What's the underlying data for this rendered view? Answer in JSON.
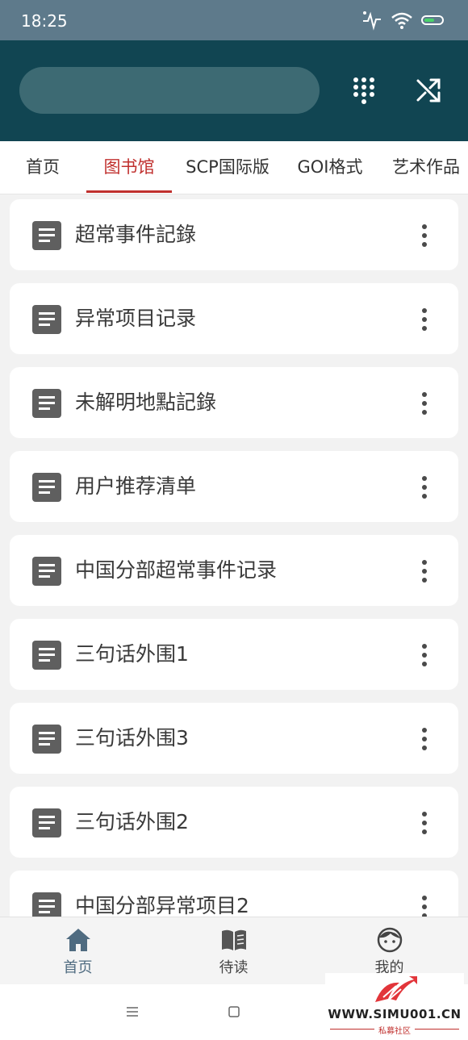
{
  "status_bar": {
    "time": "18:25"
  },
  "tabs": [
    {
      "label": "首页",
      "active": false
    },
    {
      "label": "图书馆",
      "active": true
    },
    {
      "label": "SCP国际版",
      "active": false
    },
    {
      "label": "GOI格式",
      "active": false
    },
    {
      "label": "艺术作品",
      "active": false
    }
  ],
  "list": {
    "items": [
      {
        "title": "超常事件記錄"
      },
      {
        "title": "异常项目记录"
      },
      {
        "title": "未解明地點記錄"
      },
      {
        "title": "用户推荐清单"
      },
      {
        "title": "中国分部超常事件记录"
      },
      {
        "title": "三句话外围1"
      },
      {
        "title": "三句话外围3"
      },
      {
        "title": "三句话外围2"
      },
      {
        "title": "中国分部异常项目2"
      }
    ]
  },
  "bottom_nav": {
    "items": [
      {
        "label": "首页",
        "icon": "home-icon",
        "active": true
      },
      {
        "label": "待读",
        "icon": "book-icon",
        "active": false
      },
      {
        "label": "我的",
        "icon": "face-icon",
        "active": false
      }
    ]
  },
  "watermark": {
    "text": "WWW.SIMU001.CN",
    "subtitle": "私募社区"
  },
  "colors": {
    "status_bar": "#5e7a8b",
    "header": "#114552",
    "search_box": "#3d6a73",
    "accent": "#c0302e",
    "nav_active": "#4f6b80",
    "background": "#f2f2f2"
  }
}
